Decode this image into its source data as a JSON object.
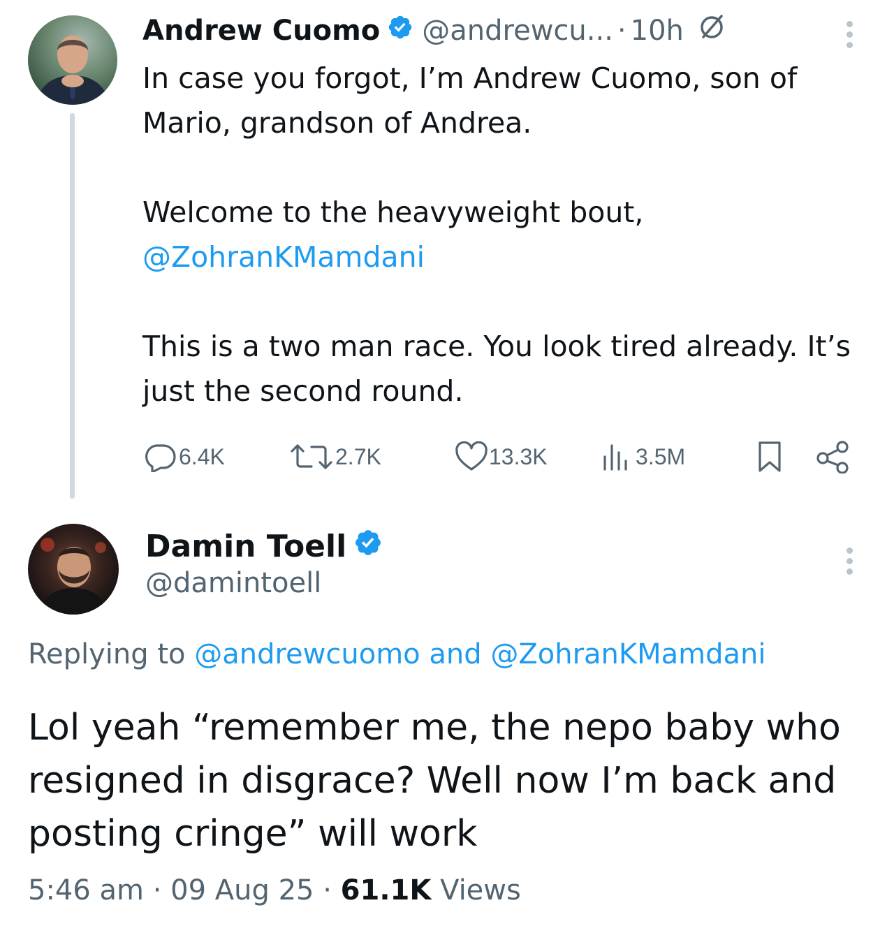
{
  "parent_tweet": {
    "author_name": "Andrew Cuomo",
    "handle": "@andrewcu...",
    "separator": "·",
    "time": "10h",
    "paragraphs": [
      {
        "text": "In case you forgot, I’m Andrew Cuomo, son of Mario, grandson of Andrea."
      },
      {
        "text": "Welcome to the heavyweight bout,",
        "mention": "@ZohranKMamdani"
      },
      {
        "text": "This is a two man race. You look tired already. It’s just the second round."
      }
    ],
    "actions": {
      "replies": "6.4K",
      "reposts": "2.7K",
      "likes": "13.3K",
      "views": "3.5M"
    }
  },
  "reply_tweet": {
    "author_name": "Damin Toell",
    "handle": "@damintoell",
    "replying_to_prefix": "Replying to",
    "replying_to_user1": "@andrewcuomo",
    "replying_to_and": "and",
    "replying_to_user2": "@ZohranKMamdani",
    "text": "Lol yeah “remember me, the nepo baby who resigned in disgrace? Well now I’m back and posting cringe” will work",
    "time": "5:46 am",
    "separator1": "·",
    "date": "09 Aug 25",
    "separator2": "·",
    "views_count": "61.1K",
    "views_label": "Views"
  },
  "colors": {
    "text": "#0f1419",
    "secondary": "#536471",
    "link": "#1d9bf0",
    "verified": "#1d9bf0",
    "thread_line": "#cfd9de"
  },
  "icons": {
    "verified": "verified-badge-icon",
    "edit": "edit-indicator-icon",
    "more": "more-vertical-icon",
    "reply": "comment-icon",
    "repost": "repost-icon",
    "like": "heart-icon",
    "views": "views-bar-chart-icon",
    "bookmark": "bookmark-icon",
    "share": "share-icon"
  }
}
